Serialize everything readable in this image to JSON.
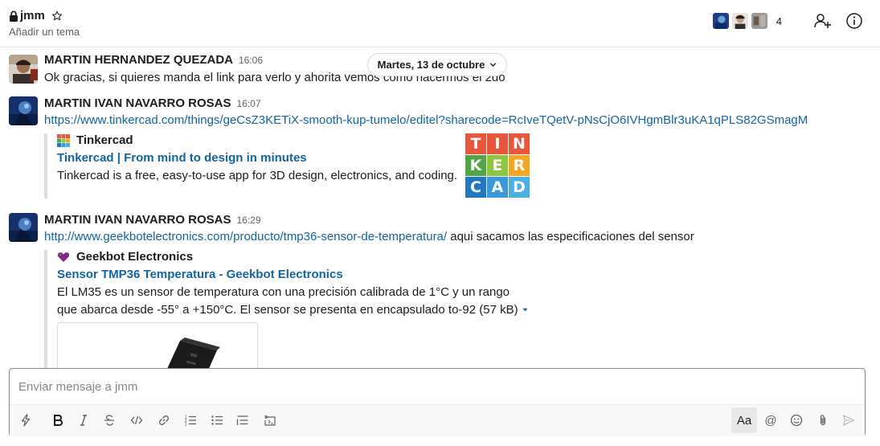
{
  "header": {
    "channel_name": "jmm",
    "topic_placeholder": "Añadir un tema",
    "member_count": "4",
    "icons": [
      "lock-icon",
      "star-icon",
      "add-member-icon",
      "info-icon"
    ]
  },
  "date_divider": {
    "label": "Martes, 13 de octubre"
  },
  "messages": [
    {
      "author": "MARTIN HERNANDEZ QUEZADA",
      "time": "16:06",
      "text": "Ok gracias, si quieres manda el link para verlo y ahorita vemos como hacermos el 2do"
    },
    {
      "author": "MARTIN IVAN NAVARRO ROSAS",
      "time": "16:07",
      "link": "https://www.tinkercad.com/things/geCsZ3KETiX-smooth-kup-tumelo/editel?sharecode=RcIveTQetV-pNsCjO6IVHgmBlr3uKA1qPLS82GSmagM",
      "attachment": {
        "site": "Tinkercad",
        "title": "Tinkercad | From mind to design in minutes",
        "description": "Tinkercad is a free, easy-to-use app for 3D design, electronics, and coding.",
        "logo_letters": [
          "T",
          "I",
          "N",
          "K",
          "E",
          "R",
          "C",
          "A",
          "D"
        ],
        "logo_colors": [
          "#e8573c",
          "#e8573c",
          "#e8573c",
          "#52a647",
          "#8cc63f",
          "#f5a623",
          "#1f78c1",
          "#3a9ad9",
          "#4ab0e3"
        ]
      }
    },
    {
      "author": "MARTIN IVAN NAVARRO ROSAS",
      "time": "16:29",
      "link": "http://www.geekbotelectronics.com/producto/tmp36-sensor-de-temperatura/",
      "text_after_link": " aqui sacamos las especificaciones del sensor",
      "attachment": {
        "site": "Geekbot Electronics",
        "title": "Sensor TMP36 Temperatura - Geekbot Electronics",
        "description_line1": "El LM35 es un sensor de temperatura con una precisión calibrada de 1°C y un rango",
        "description_line2": "que abarca desde -55° a +150°C. El sensor se presenta en encapsulado to-92 (57 kB)",
        "collapse_icon": "caret-down-icon"
      }
    }
  ],
  "composer": {
    "placeholder": "Enviar mensaje a jmm",
    "aa_label": "Aa",
    "at_label": "@"
  }
}
